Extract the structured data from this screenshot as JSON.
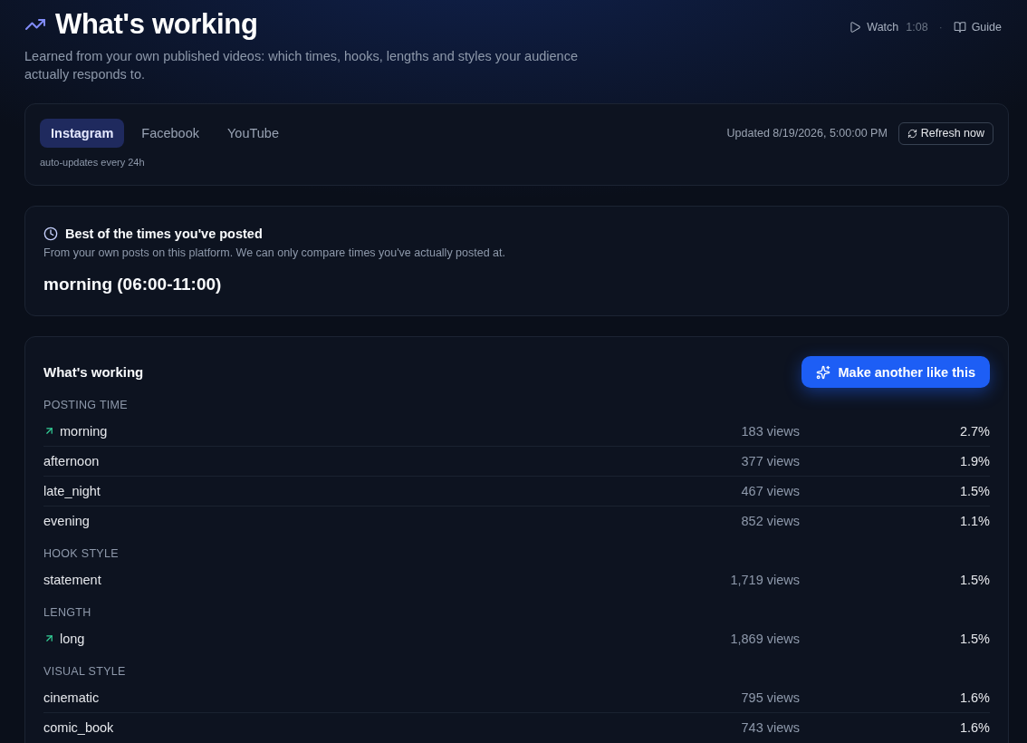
{
  "header": {
    "title": "What's working",
    "subtitle": "Learned from your own published videos: which times, hooks, lengths and styles your audience actually responds to.",
    "watch": {
      "label": "Watch",
      "duration": "1:08"
    },
    "separator": "·",
    "guide": {
      "label": "Guide"
    }
  },
  "platform_card": {
    "tabs": [
      {
        "label": "Instagram",
        "selected": true
      },
      {
        "label": "Facebook",
        "selected": false
      },
      {
        "label": "YouTube",
        "selected": false
      }
    ],
    "note": "auto-updates every 24h",
    "updated": "Updated 8/19/2026, 5:00:00 PM",
    "refresh_button": "Refresh now"
  },
  "best_time_card": {
    "title": "Best of the times you've posted",
    "description": "From your own posts on this platform. We can only compare times you've actually posted at.",
    "value": "morning (06:00-11:00)"
  },
  "insights_card": {
    "title": "What's working",
    "action_button": "Make another like this",
    "sections": [
      {
        "label": "POSTING TIME",
        "rows": [
          {
            "name": "morning",
            "trending": true,
            "views": "183 views",
            "rate": "2.7%"
          },
          {
            "name": "afternoon",
            "trending": false,
            "views": "377 views",
            "rate": "1.9%"
          },
          {
            "name": "late_night",
            "trending": false,
            "views": "467 views",
            "rate": "1.5%"
          },
          {
            "name": "evening",
            "trending": false,
            "views": "852 views",
            "rate": "1.1%"
          }
        ]
      },
      {
        "label": "HOOK STYLE",
        "rows": [
          {
            "name": "statement",
            "trending": false,
            "views": "1,719 views",
            "rate": "1.5%"
          }
        ]
      },
      {
        "label": "LENGTH",
        "rows": [
          {
            "name": "long",
            "trending": true,
            "views": "1,869 views",
            "rate": "1.5%"
          }
        ]
      },
      {
        "label": "VISUAL STYLE",
        "rows": [
          {
            "name": "cinematic",
            "trending": false,
            "views": "795 views",
            "rate": "1.6%"
          },
          {
            "name": "comic_book",
            "trending": false,
            "views": "743 views",
            "rate": "1.6%"
          }
        ]
      }
    ]
  }
}
